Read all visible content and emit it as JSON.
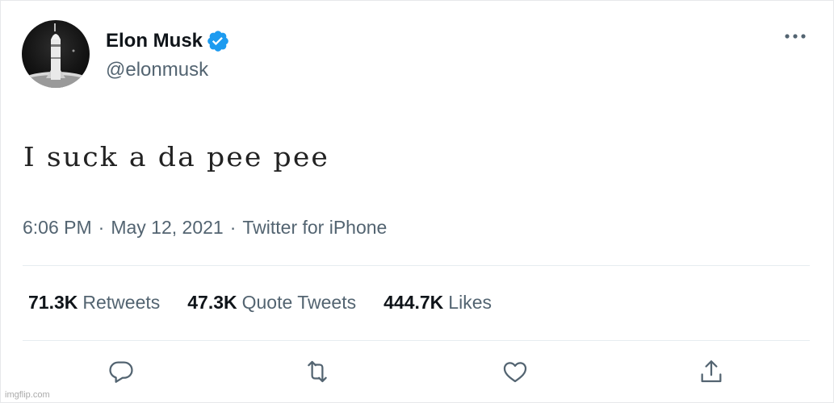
{
  "tweet": {
    "author": {
      "display_name": "Elon Musk",
      "handle": "@elonmusk",
      "verified": true,
      "avatar": "rocket-avatar"
    },
    "text": "I suck a da pee pee",
    "meta": {
      "time": "6:06 PM",
      "separator": "·",
      "date": "May 12, 2021",
      "source": "Twitter for iPhone"
    },
    "stats": [
      {
        "value": "71.3K",
        "label": "Retweets"
      },
      {
        "value": "47.3K",
        "label": "Quote Tweets"
      },
      {
        "value": "444.7K",
        "label": "Likes"
      }
    ],
    "actions": [
      {
        "name": "reply",
        "icon": "reply-icon"
      },
      {
        "name": "retweet",
        "icon": "retweet-icon"
      },
      {
        "name": "like",
        "icon": "heart-icon"
      },
      {
        "name": "share",
        "icon": "share-icon"
      }
    ],
    "more_icon": "more-icon"
  },
  "watermark": "imgflip.com",
  "colors": {
    "text_primary": "#0f1419",
    "text_secondary": "#536471",
    "verified_blue": "#1d9bf0",
    "divider": "#e6ecf0"
  }
}
